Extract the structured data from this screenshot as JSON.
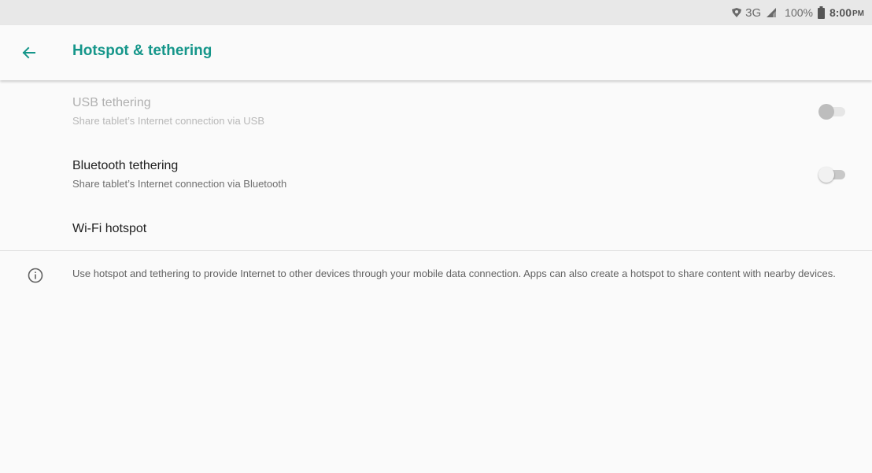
{
  "status_bar": {
    "network": "3G",
    "battery": "100%",
    "time": "8:00",
    "ampm": "PM",
    "icons": [
      "vpn-key-icon",
      "signal-icon",
      "battery-icon"
    ]
  },
  "app_bar": {
    "title": "Hotspot & tethering",
    "back_icon": "arrow-back-icon",
    "title_color": "#15968a"
  },
  "settings": [
    {
      "title": "USB tethering",
      "summary": "Share tablet’s Internet connection via USB",
      "enabled": false,
      "toggle_on": false
    },
    {
      "title": "Bluetooth tethering",
      "summary": "Share tablet’s Internet connection via Bluetooth",
      "enabled": true,
      "toggle_on": false
    },
    {
      "title": "Wi-Fi hotspot"
    }
  ],
  "footer_info": {
    "icon": "info-icon",
    "text": "Use hotspot and tethering to provide Internet to other devices through your mobile data connection. Apps can also create a hotspot to share content with nearby devices."
  }
}
